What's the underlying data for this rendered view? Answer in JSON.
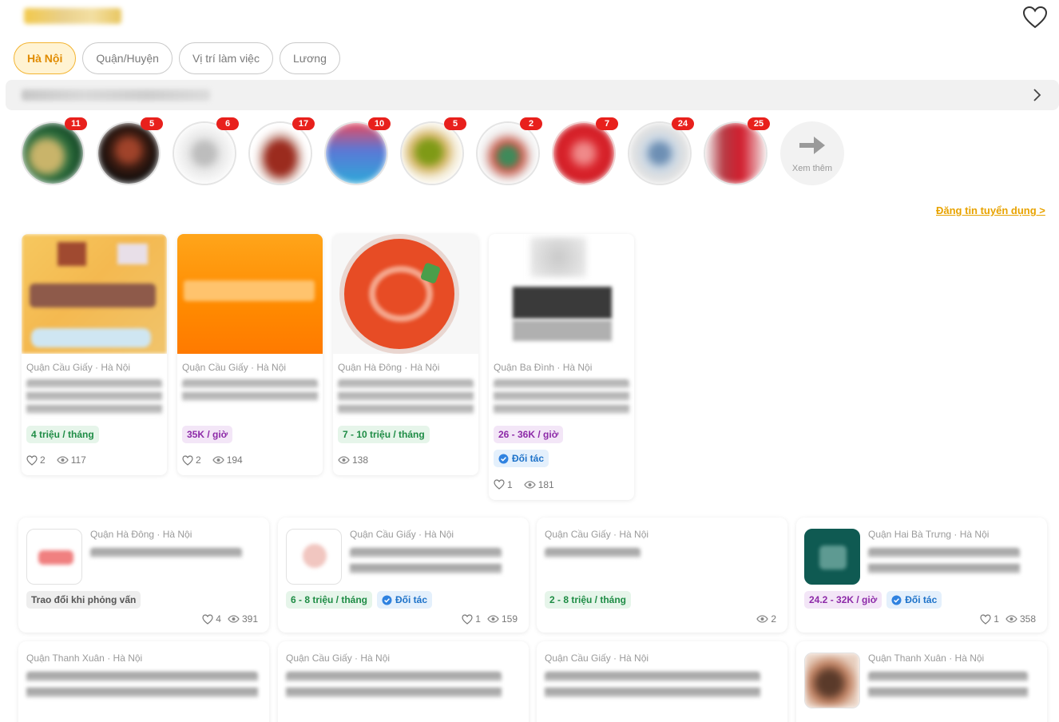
{
  "filters": [
    "Hà Nội",
    "Quận/Huyện",
    "Vị trí làm việc",
    "Lương"
  ],
  "stories": {
    "badges": [
      "11",
      "5",
      "6",
      "17",
      "10",
      "5",
      "2",
      "7",
      "24",
      "25"
    ],
    "more_label": "Xem thêm"
  },
  "post_job_link": "Đăng tin tuyển dụng >",
  "partner_label": "Đối tác",
  "grid_jobs": [
    {
      "location": "Quận Cầu Giấy · Hà Nội",
      "salary": "4 triệu / tháng",
      "likes": "2",
      "views": "117"
    },
    {
      "location": "Quận Cầu Giấy · Hà Nội",
      "salary": "35K / giờ",
      "likes": "2",
      "views": "194"
    },
    {
      "location": "Quận Hà Đông · Hà Nội",
      "salary": "7 - 10 triệu / tháng",
      "views": "138"
    },
    {
      "location": "Quận Ba Đình · Hà Nội",
      "salary": "26 - 36K / giờ",
      "likes": "1",
      "views": "181"
    }
  ],
  "wide_jobs": [
    {
      "location": "Quận Hà Đông · Hà Nội",
      "salary": "Trao đổi khi phỏng vấn",
      "likes": "4",
      "views": "391"
    },
    {
      "location": "Quận Cầu Giấy · Hà Nội",
      "salary": "6 - 8 triệu / tháng",
      "likes": "1",
      "views": "159"
    },
    {
      "location": "Quận Cầu Giấy · Hà Nội",
      "salary": "2 - 8 triệu / tháng",
      "views": "2"
    },
    {
      "location": "Quận Hai Bà Trưng · Hà Nội",
      "salary": "24.2 - 32K / giờ",
      "likes": "1",
      "views": "358"
    },
    {
      "location": "Quận Thanh Xuân · Hà Nội"
    },
    {
      "location": "Quận Cầu Giấy · Hà Nội"
    },
    {
      "location": "Quận Cầu Giấy · Hà Nội"
    },
    {
      "location": "Quận Thanh Xuân · Hà Nội"
    }
  ],
  "colors": {
    "accent": "#f3b431",
    "badge": "#e8201c",
    "link": "#e8a300"
  }
}
